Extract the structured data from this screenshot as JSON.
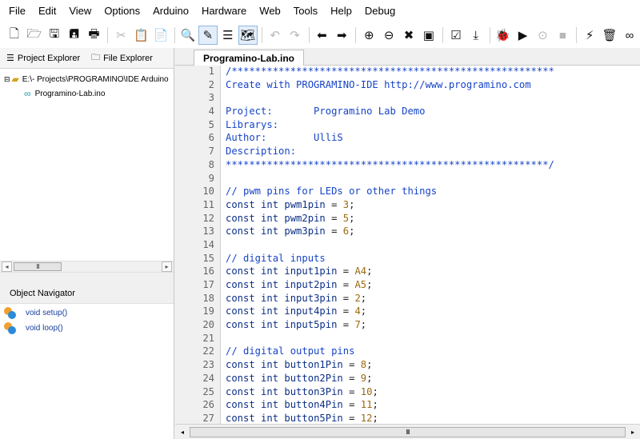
{
  "menu": [
    "File",
    "Edit",
    "View",
    "Options",
    "Arduino",
    "Hardware",
    "Web",
    "Tools",
    "Help",
    "Debug"
  ],
  "left_tabs": {
    "project": "Project Explorer",
    "file": "File Explorer"
  },
  "tree": {
    "root": "E:\\- Projects\\PROGRAMINO\\IDE Arduino",
    "file": "Programino-Lab.ino"
  },
  "object_navigator": {
    "title": "Object Navigator",
    "items": [
      "void setup()",
      "void loop()"
    ]
  },
  "editor_tab": "Programino-Lab.ino",
  "lines": [
    {
      "n": "1",
      "t": "/*******************************************************"
    },
    {
      "n": "2",
      "t": "Create with PROGRAMINO-IDE http://www.programino.com"
    },
    {
      "n": "3",
      "t": ""
    },
    {
      "n": "4",
      "t": "Project:       Programino Lab Demo"
    },
    {
      "n": "5",
      "t": "Librarys:"
    },
    {
      "n": "6",
      "t": "Author:        UlliS"
    },
    {
      "n": "7",
      "t": "Description:"
    },
    {
      "n": "8",
      "t": "*******************************************************/"
    },
    {
      "n": "9",
      "t": ""
    },
    {
      "n": "10",
      "t": "// pwm pins for LEDs or other things"
    },
    {
      "n": "11",
      "t": "const int pwm1pin = 3;"
    },
    {
      "n": "12",
      "t": "const int pwm2pin = 5;"
    },
    {
      "n": "13",
      "t": "const int pwm3pin = 6;"
    },
    {
      "n": "14",
      "t": ""
    },
    {
      "n": "15",
      "t": "// digital inputs"
    },
    {
      "n": "16",
      "t": "const int input1pin = A4;"
    },
    {
      "n": "17",
      "t": "const int input2pin = A5;"
    },
    {
      "n": "18",
      "t": "const int input3pin = 2;"
    },
    {
      "n": "19",
      "t": "const int input4pin = 4;"
    },
    {
      "n": "20",
      "t": "const int input5pin = 7;"
    },
    {
      "n": "21",
      "t": ""
    },
    {
      "n": "22",
      "t": "// digital output pins"
    },
    {
      "n": "23",
      "t": "const int button1Pin = 8;"
    },
    {
      "n": "24",
      "t": "const int button2Pin = 9;"
    },
    {
      "n": "25",
      "t": "const int button3Pin = 10;"
    },
    {
      "n": "26",
      "t": "const int button4Pin = 11;"
    },
    {
      "n": "27",
      "t": "const int button5Pin = 12;"
    }
  ],
  "colors": {
    "comment": "#1744c8",
    "keyword": "#0c2f86",
    "number": "#9a6a10",
    "nav_link": "#163d9c"
  }
}
